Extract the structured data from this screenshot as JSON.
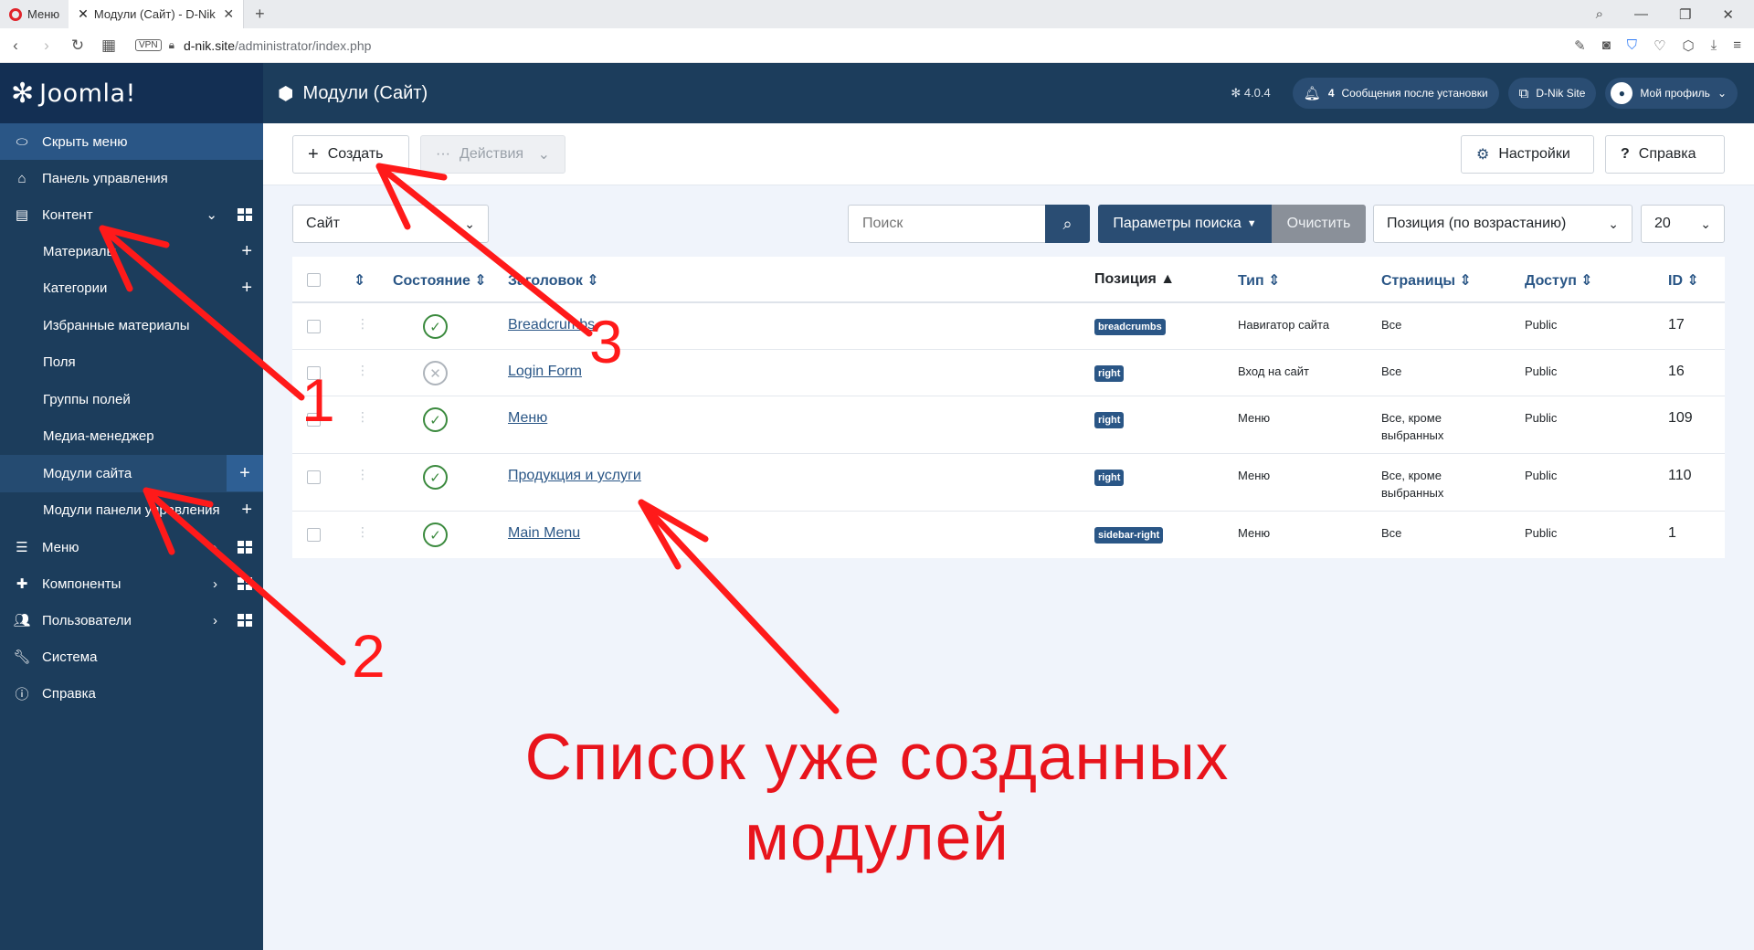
{
  "browser": {
    "tab_menu": "Меню",
    "tab_active": "Модули (Сайт) - D-Nik Site",
    "url_host": "d-nik.site",
    "url_path": "/administrator/index.php",
    "vpn_label": "VPN"
  },
  "header": {
    "logo_text": "Joomla!",
    "page_title": "Модули (Сайт)",
    "version": "4.0.4",
    "notif_count": "4",
    "notif_label": "Сообщения после установки",
    "site_label": "D-Nik Site",
    "profile_label": "Мой профиль"
  },
  "sidebar": {
    "hide_menu": "Скрыть меню",
    "dashboard": "Панель управления",
    "content": "Контент",
    "sub": [
      "Материалы",
      "Категории",
      "Избранные материалы",
      "Поля",
      "Группы полей",
      "Медиа-менеджер",
      "Модули сайта",
      "Модули панели управления"
    ],
    "menu": "Меню",
    "components": "Компоненты",
    "users": "Пользователи",
    "system": "Система",
    "help": "Справка"
  },
  "toolbar": {
    "create": "Создать",
    "actions": "Действия",
    "settings": "Настройки",
    "help": "Справка"
  },
  "filters": {
    "client": "Сайт",
    "search_placeholder": "Поиск",
    "search_params": "Параметры поиска",
    "clear": "Очистить",
    "sort": "Позиция (по возрастанию)",
    "limit": "20"
  },
  "table": {
    "headers": {
      "status": "Состояние",
      "title": "Заголовок",
      "position": "Позиция",
      "type": "Тип",
      "pages": "Страницы",
      "access": "Доступ",
      "id": "ID"
    },
    "rows": [
      {
        "title": "Breadcrumbs",
        "position": "breadcrumbs",
        "type": "Навигатор сайта",
        "pages": "Все",
        "access": "Public",
        "id": "17",
        "published": true
      },
      {
        "title": "Login Form",
        "position": "right",
        "type": "Вход на сайт",
        "pages": "Все",
        "access": "Public",
        "id": "16",
        "published": false
      },
      {
        "title": "Меню",
        "position": "right",
        "type": "Меню",
        "pages": "Все, кроме выбранных",
        "access": "Public",
        "id": "109",
        "published": true
      },
      {
        "title": "Продукция и услуги",
        "position": "right",
        "type": "Меню",
        "pages": "Все, кроме выбранных",
        "access": "Public",
        "id": "110",
        "published": true
      },
      {
        "title": "Main Menu",
        "position": "sidebar-right",
        "type": "Меню",
        "pages": "Все",
        "access": "Public",
        "id": "1",
        "published": true
      }
    ]
  },
  "annotations": {
    "num1": "1",
    "num2": "2",
    "num3": "3",
    "caption": "Список уже созданных модулей",
    "color": "#ff1a1a"
  }
}
